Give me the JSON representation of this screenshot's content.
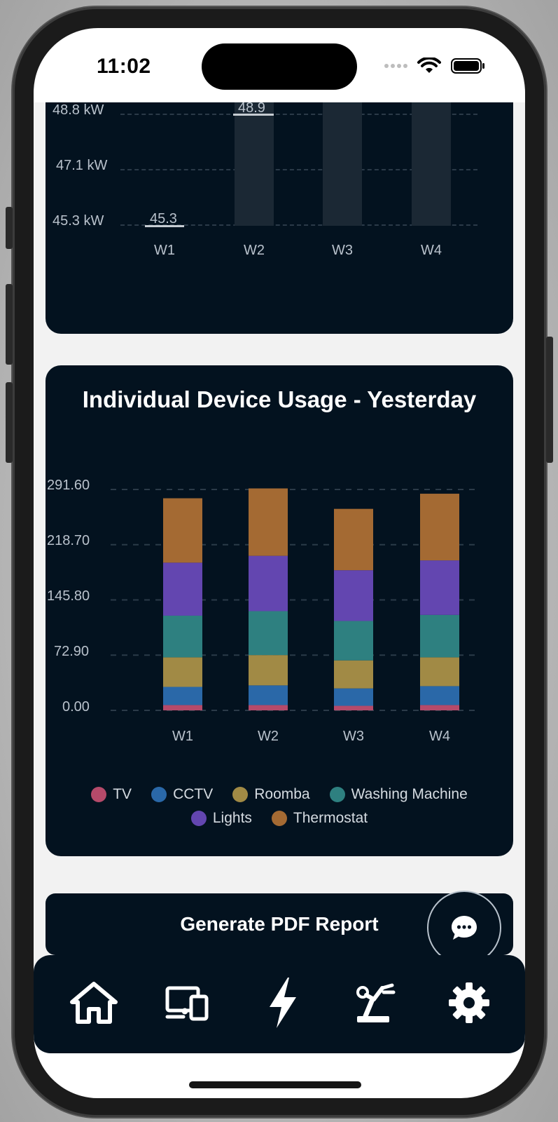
{
  "status_bar": {
    "time": "11:02"
  },
  "top_chart": {
    "chart_data": {
      "type": "bar",
      "categories": [
        "W1",
        "W2",
        "W3",
        "W4"
      ],
      "y_tick_labels": [
        "48.8 kW",
        "47.1 kW",
        "45.3 kW"
      ],
      "data_labels": [
        "45.3",
        "48.9",
        "",
        ""
      ]
    }
  },
  "device_chart": {
    "title": "Individual Device Usage - Yesterday",
    "chart_data": {
      "type": "bar",
      "stacked": true,
      "title": "Individual Device Usage - Yesterday",
      "categories": [
        "W1",
        "W2",
        "W3",
        "W4"
      ],
      "y_tick_labels": [
        "291.60",
        "218.70",
        "145.80",
        "72.90",
        "0.00"
      ],
      "ylim": [
        0,
        291.6
      ],
      "grid": true,
      "legend_position": "bottom",
      "series": [
        {
          "name": "TV",
          "color": "#b54a6a",
          "values": [
            7,
            7,
            6,
            7
          ]
        },
        {
          "name": "CCTV",
          "color": "#2a68a8",
          "values": [
            24,
            26,
            23,
            25
          ]
        },
        {
          "name": "Roomba",
          "color": "#a18a45",
          "values": [
            39,
            40,
            37,
            38
          ]
        },
        {
          "name": "Washing Machine",
          "color": "#2e8080",
          "values": [
            55,
            58,
            52,
            56
          ]
        },
        {
          "name": "Lights",
          "color": "#6346b0",
          "values": [
            70,
            73,
            67,
            72
          ]
        },
        {
          "name": "Thermostat",
          "color": "#a46a33",
          "values": [
            85,
            89,
            81,
            88
          ]
        }
      ]
    }
  },
  "actions": {
    "pdf_button_label": "Generate PDF Report"
  },
  "tabbar": {
    "items": [
      "home-icon",
      "devices-icon",
      "energy-icon",
      "automation-icon",
      "settings-icon"
    ]
  }
}
